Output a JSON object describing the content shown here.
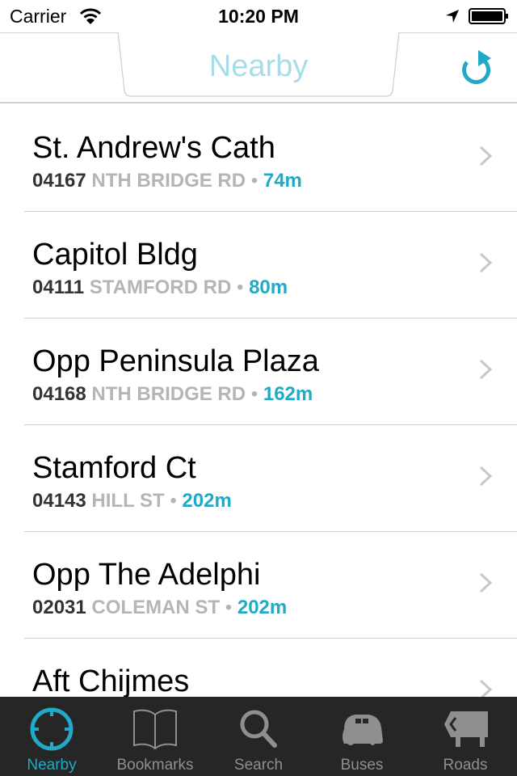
{
  "status_bar": {
    "carrier": "Carrier",
    "time": "10:20 PM",
    "icons": [
      "wifi-icon",
      "location-arrow-icon",
      "battery-icon"
    ]
  },
  "nav": {
    "title": "Nearby",
    "refresh_icon": "refresh-icon",
    "accent_color": "#22a9c6",
    "title_color": "#a6dde9"
  },
  "stops": [
    {
      "name": "St. Andrew's Cath",
      "code": "04167",
      "road": "NTH BRIDGE RD",
      "separator": "•",
      "distance": "74m"
    },
    {
      "name": "Capitol Bldg",
      "code": "04111",
      "road": "STAMFORD RD",
      "separator": "•",
      "distance": "80m"
    },
    {
      "name": "Opp Peninsula Plaza",
      "code": "04168",
      "road": "NTH BRIDGE RD",
      "separator": "•",
      "distance": "162m"
    },
    {
      "name": "Stamford Ct",
      "code": "04143",
      "road": "HILL ST",
      "separator": "•",
      "distance": "202m"
    },
    {
      "name": "Opp The Adelphi",
      "code": "02031",
      "road": "COLEMAN ST",
      "separator": "•",
      "distance": "202m"
    },
    {
      "name": "Aft Chijmes",
      "code": "",
      "road": "",
      "separator": "",
      "distance": ""
    }
  ],
  "tabs": [
    {
      "label": "Nearby",
      "icon": "crosshair-icon",
      "active": true
    },
    {
      "label": "Bookmarks",
      "icon": "book-icon",
      "active": false
    },
    {
      "label": "Search",
      "icon": "search-icon",
      "active": false
    },
    {
      "label": "Buses",
      "icon": "bus-icon",
      "active": false
    },
    {
      "label": "Roads",
      "icon": "road-sign-icon",
      "active": false
    }
  ]
}
